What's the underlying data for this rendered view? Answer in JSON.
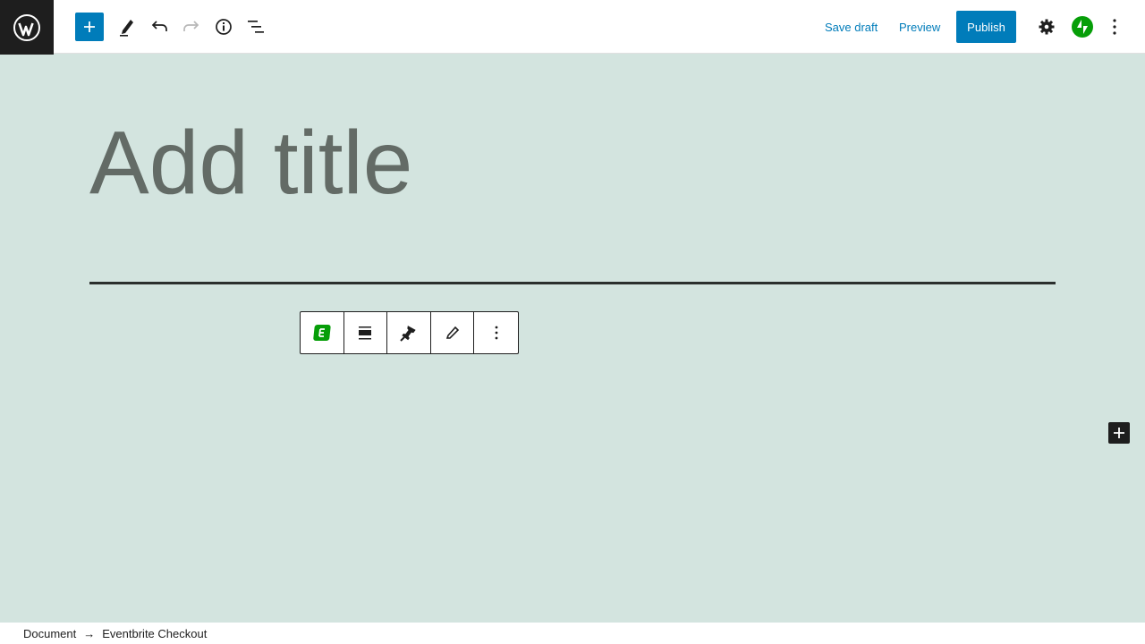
{
  "header": {
    "logo": "wordpress-logo",
    "tools": {
      "add_block": "plus-icon",
      "edit": "pencil-icon",
      "undo": "undo-icon",
      "redo": "redo-icon",
      "info": "info-icon",
      "outline": "list-view-icon"
    },
    "save_draft_label": "Save draft",
    "preview_label": "Preview",
    "publish_label": "Publish",
    "settings_icon": "gear-icon",
    "jetpack_icon": "jetpack-icon",
    "options_icon": "more-vertical-icon"
  },
  "editor": {
    "title_placeholder": "Add title",
    "block_toolbar": [
      "eventbrite-icon",
      "align-icon",
      "pin-icon",
      "pencil-icon",
      "more-vertical-icon"
    ]
  },
  "colors": {
    "accent": "#007cba",
    "canvas": "#d3e4df",
    "dark": "#1e1e1e",
    "jetpack": "#069e08"
  },
  "footer": {
    "crumb_root": "Document",
    "separator": "→",
    "crumb_current": "Eventbrite Checkout"
  }
}
